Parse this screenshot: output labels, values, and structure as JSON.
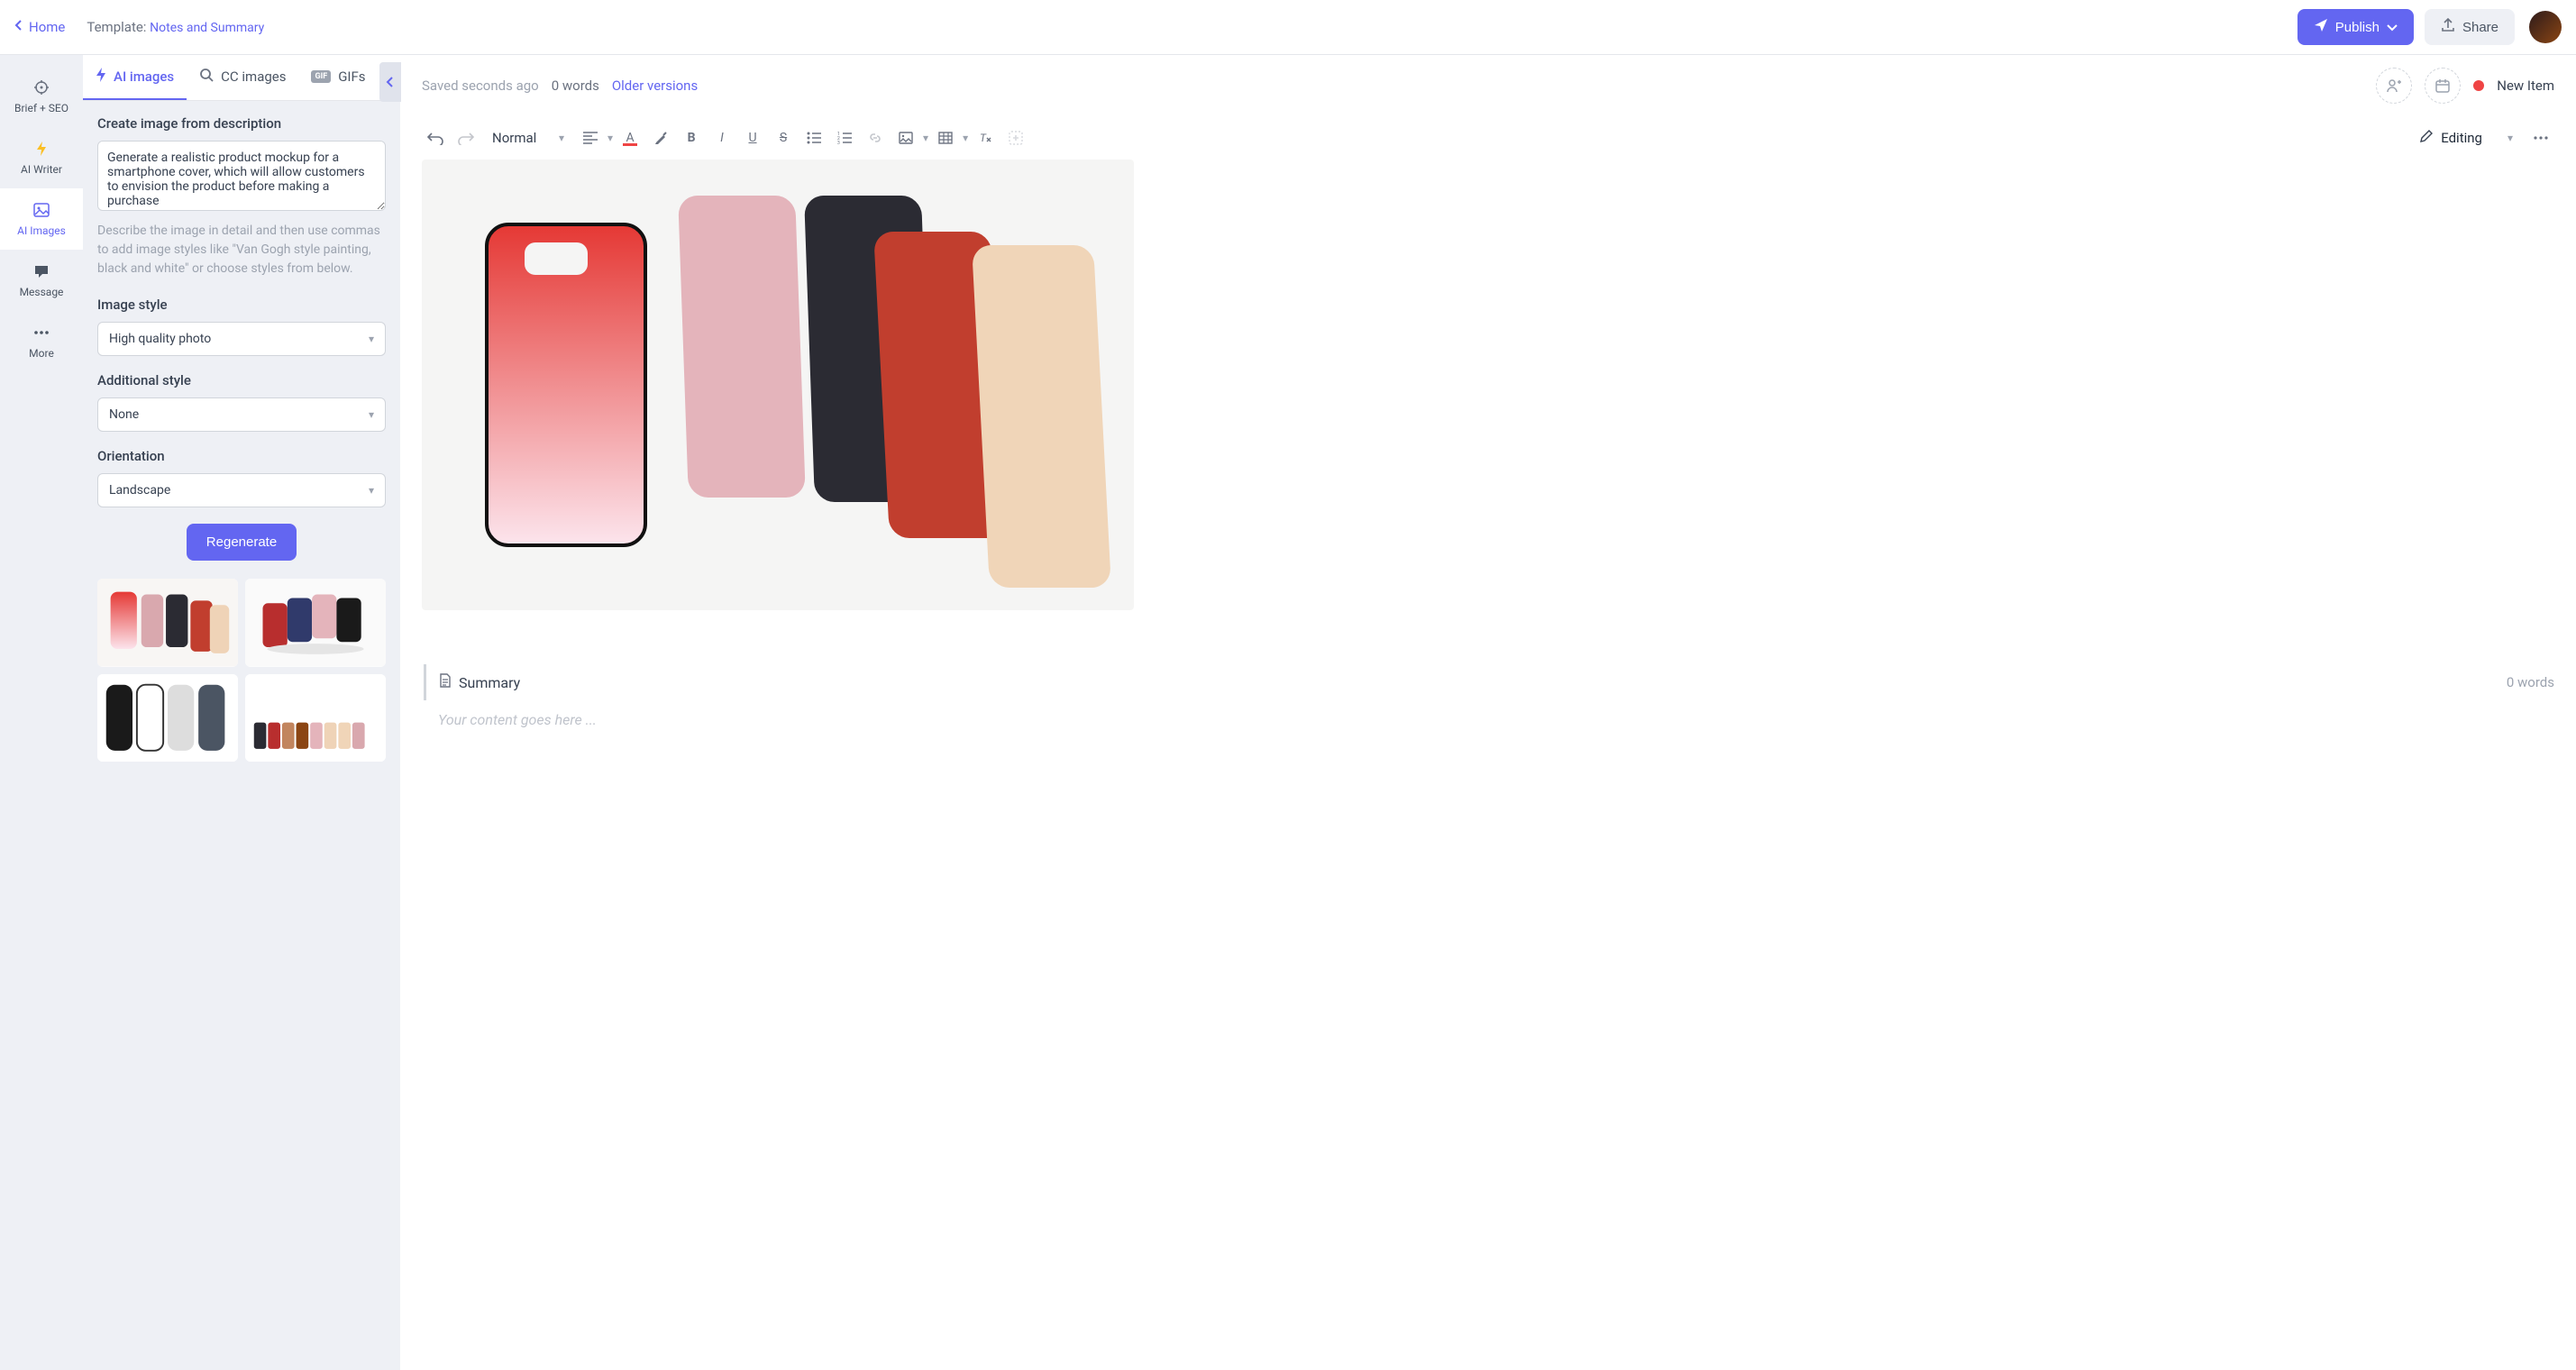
{
  "header": {
    "home": "Home",
    "template_prefix": "Template: ",
    "template_name": "Notes and Summary",
    "publish": "Publish",
    "share": "Share"
  },
  "rail": {
    "brief": "Brief + SEO",
    "writer": "AI Writer",
    "images": "AI Images",
    "message": "Message",
    "more": "More"
  },
  "sidebar": {
    "tabs": {
      "ai": "AI images",
      "cc": "CC images",
      "gifs": "GIFs"
    },
    "create_label": "Create image from description",
    "prompt": "Generate a realistic product mockup for a smartphone cover, which will allow customers to envision the product before making a purchase",
    "helper": "Describe the image in detail and then use commas to add image styles like \"Van Gogh style painting, black and white\" or choose styles from below.",
    "style_label": "Image style",
    "style_value": "High quality photo",
    "addl_label": "Additional style",
    "addl_value": "None",
    "orient_label": "Orientation",
    "orient_value": "Landscape",
    "regenerate": "Regenerate"
  },
  "editor": {
    "saved": "Saved seconds ago",
    "words": "0 words",
    "versions": "Older versions",
    "status": "New Item",
    "format": "Normal",
    "mode": "Editing",
    "summary_label": "Summary",
    "summary_words": "0 words",
    "placeholder": "Your content goes here ..."
  }
}
